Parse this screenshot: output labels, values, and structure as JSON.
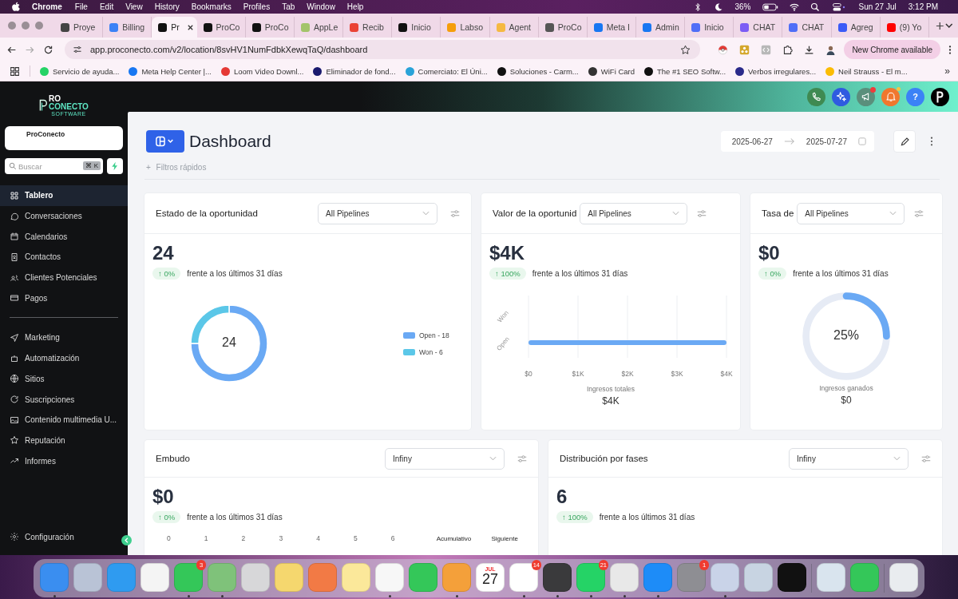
{
  "menubar": {
    "app": "Chrome",
    "menus": [
      "File",
      "Edit",
      "View",
      "History",
      "Bookmarks",
      "Profiles",
      "Tab",
      "Window",
      "Help"
    ],
    "battery": "36%",
    "date": "Sun 27 Jul",
    "time": "3:12 PM"
  },
  "tabs": [
    {
      "label": "Proye",
      "selected": false,
      "color": "#444444"
    },
    {
      "label": "Billing",
      "selected": false,
      "color": "#3b82f6"
    },
    {
      "label": "Pr",
      "selected": true,
      "color": "#111111"
    },
    {
      "label": "ProCo",
      "selected": false,
      "color": "#111111"
    },
    {
      "label": "ProCo",
      "selected": false,
      "color": "#111111"
    },
    {
      "label": "AppLe",
      "selected": false,
      "color": "#a3c46a"
    },
    {
      "label": "Recib",
      "selected": false,
      "color": "#ea4335"
    },
    {
      "label": "Inicio",
      "selected": false,
      "color": "#111111"
    },
    {
      "label": "Labso",
      "selected": false,
      "color": "#f59e0b"
    },
    {
      "label": "Agent",
      "selected": false,
      "color": "#f5b942"
    },
    {
      "label": "ProCo",
      "selected": false,
      "color": "#555555"
    },
    {
      "label": "Meta I",
      "selected": false,
      "color": "#1877f2"
    },
    {
      "label": "Admin",
      "selected": false,
      "color": "#1877f2"
    },
    {
      "label": "Inicio",
      "selected": false,
      "color": "#4f6ef7"
    },
    {
      "label": "CHAT",
      "selected": false,
      "color": "#7c5cf5"
    },
    {
      "label": "CHAT",
      "selected": false,
      "color": "#4f6ef7"
    },
    {
      "label": "Agreg",
      "selected": false,
      "color": "#3b5bf7"
    },
    {
      "label": "(9) Yo",
      "selected": false,
      "color": "#ff0000"
    }
  ],
  "toolbar": {
    "url": "app.proconecto.com/v2/location/8svHV1NumFdbkXewqTaQ/dashboard",
    "update_button": "New Chrome available"
  },
  "bookmarks": [
    {
      "label": "Servicio de ayuda...",
      "color": "#25d366"
    },
    {
      "label": "Meta Help Center |...",
      "color": "#1877f2"
    },
    {
      "label": "Loom Video Downl...",
      "color": "#e53935"
    },
    {
      "label": "Eliminador de fond...",
      "color": "#1a1a6e"
    },
    {
      "label": "Comerciato: El Úni...",
      "color": "#2aa3d8"
    },
    {
      "label": "Soluciones - Carm...",
      "color": "#111111"
    },
    {
      "label": "WiFi Card",
      "color": "#333333"
    },
    {
      "label": "The #1 SEO Softw...",
      "color": "#111111"
    },
    {
      "label": "Verbos irregulares...",
      "color": "#2a2a8a"
    },
    {
      "label": "Neil Strauss - El m...",
      "color": "#fbbc04"
    }
  ],
  "bookmarks_more": "»",
  "app": {
    "logo": {
      "line1": "RO",
      "line2": "CONECTO",
      "line3": "SOFTWARE"
    },
    "header_buttons": [
      {
        "kind": "phone",
        "color": "#3f8a52",
        "dot": false
      },
      {
        "kind": "sparkle",
        "color": "#2f5be0",
        "dot": false
      },
      {
        "kind": "megaphone",
        "color": "#5a8f7c",
        "dot": true
      },
      {
        "kind": "bell",
        "color": "#f0772e",
        "dot": true
      },
      {
        "kind": "help",
        "label": "?",
        "color": "#3b82f6",
        "dot": false
      },
      {
        "kind": "avatar",
        "color": "#000000",
        "dot": false
      }
    ],
    "sidebar": {
      "account": "ProConecto",
      "search_placeholder": "Buscar",
      "shortcut": "⌘ K",
      "items": [
        {
          "label": "Tablero",
          "kind": "grid",
          "selected": true
        },
        {
          "label": "Conversaciones",
          "kind": "chat",
          "selected": false
        },
        {
          "label": "Calendarios",
          "kind": "calendar",
          "selected": false
        },
        {
          "label": "Contactos",
          "kind": "contacts",
          "selected": false
        },
        {
          "label": "Clientes Potenciales",
          "kind": "people",
          "selected": false
        },
        {
          "label": "Pagos",
          "kind": "card",
          "selected": false
        }
      ],
      "items_2": [
        {
          "label": "Marketing",
          "kind": "send",
          "selected": false
        },
        {
          "label": "Automatización",
          "kind": "bot",
          "selected": false
        },
        {
          "label": "Sitios",
          "kind": "globe",
          "selected": false
        },
        {
          "label": "Suscripciones",
          "kind": "refresh",
          "selected": false
        },
        {
          "label": "Contenido multimedia U...",
          "kind": "image",
          "selected": false
        },
        {
          "label": "Reputación",
          "kind": "star",
          "selected": false
        },
        {
          "label": "Informes",
          "kind": "trend",
          "selected": false
        }
      ],
      "footer_item": "Configuración"
    },
    "dashboard": {
      "title": "Dashboard",
      "quick_filters_icon": "+",
      "quick_filters": "Filtros rápidos",
      "date_from": "2025-06-27",
      "date_to": "2025-07-27",
      "row_1": [
        {
          "kind": "donut",
          "title": "Estado de la oportunidad",
          "select": "All Pipelines",
          "value": "24",
          "change": "↑ 0%",
          "compare": "frente a los últimos 31 días",
          "center": "24",
          "legend": [
            {
              "color": "#6aa9f4"
            },
            {
              "color": "#5bc7e8"
            }
          ],
          "chart_data": {
            "type": "donut",
            "categories": [
              "Open - 18",
              "Won - 6"
            ],
            "values": [
              75,
              25
            ]
          }
        },
        {
          "kind": "bar",
          "title": "Valor de la oportunid",
          "select": "All Pipelines",
          "value": "$4K",
          "change": "↑ 100%",
          "compare": "frente a los últimos 31 días",
          "total": "$4K",
          "chart_data": {
            "type": "bar",
            "orientation": "horizontal",
            "grid": true,
            "categories": [
              "Won",
              "Open"
            ],
            "values": [
              0,
              4000
            ],
            "xlabel": "Ingresos totales",
            "xlim": [
              0,
              4000
            ],
            "xticks": [
              {
                "value": 0,
                "label": "$0"
              },
              {
                "value": 1000,
                "label": "$1K"
              },
              {
                "value": 2000,
                "label": "$2K"
              },
              {
                "value": 3000,
                "label": "$3K"
              },
              {
                "value": 4000,
                "label": "$4K"
              }
            ]
          }
        },
        {
          "kind": "gauge",
          "title": "Tasa de",
          "select": "All Pipelines",
          "value": "$0",
          "change": "↑ 0%",
          "compare": "frente a los últimos 31 días",
          "level": 0.25,
          "label": "25%",
          "caption": "Ingresos ganados",
          "total": "$0"
        }
      ],
      "row_2": [
        {
          "kind": "funnel",
          "title": "Embudo",
          "select": "Infiny",
          "value": "$0",
          "change": "↑ 0%",
          "compare": "frente a los últimos 31 días",
          "axis": [
            "0",
            "1",
            "2",
            "3",
            "4",
            "5",
            "6"
          ],
          "columns": [
            "Acumulativo",
            "Siguiente"
          ]
        },
        {
          "kind": "stages",
          "title": "Distribución por fases",
          "select": "Infiny",
          "value": "6",
          "change": "↑ 100%",
          "compare": "frente a los últimos 31 días"
        }
      ]
    }
  },
  "dock": [
    {
      "kind": "app",
      "color": "#3a8ef0",
      "running": true
    },
    {
      "kind": "app",
      "color": "#b9c3d6",
      "running": false
    },
    {
      "kind": "app",
      "color": "#2f9bf0",
      "running": false
    },
    {
      "kind": "app",
      "color": "#f4f4f4",
      "running": false
    },
    {
      "kind": "app",
      "color": "#34c759",
      "running": true,
      "badge": "3"
    },
    {
      "kind": "app",
      "color": "#7fc27a",
      "running": true
    },
    {
      "kind": "app",
      "color": "#d7d7d9",
      "running": false
    },
    {
      "kind": "app",
      "color": "#f5d76e",
      "running": false
    },
    {
      "kind": "app",
      "color": "#f27a45",
      "running": false
    },
    {
      "kind": "app",
      "color": "#fbe89a",
      "running": false
    },
    {
      "kind": "app",
      "color": "#f7f7f7",
      "running": true
    },
    {
      "kind": "app",
      "color": "#34c759",
      "running": false
    },
    {
      "kind": "app",
      "color": "#f4a03a",
      "running": true
    },
    {
      "kind": "calendar",
      "month": "JUL",
      "day": "27",
      "running": false
    },
    {
      "kind": "app",
      "color": "#ffffff",
      "running": true,
      "badge": "14"
    },
    {
      "kind": "app",
      "color": "#3a3a3c",
      "running": true
    },
    {
      "kind": "app",
      "color": "#25d366",
      "running": true,
      "badge": "21"
    },
    {
      "kind": "app",
      "color": "#e8e8e8",
      "running": true
    },
    {
      "kind": "app",
      "color": "#1d8cf8",
      "running": true
    },
    {
      "kind": "app",
      "color": "#8e8e93",
      "running": false,
      "badge": "1"
    },
    {
      "kind": "app",
      "color": "#c9d3e8",
      "running": true
    },
    {
      "kind": "app",
      "color": "#c8d4e2",
      "running": false
    },
    {
      "kind": "app",
      "color": "#111111",
      "running": false
    },
    {
      "kind": "separator"
    },
    {
      "kind": "app",
      "color": "#d9e4ee",
      "running": false
    },
    {
      "kind": "app",
      "color": "#34c759",
      "running": false
    },
    {
      "kind": "separator"
    },
    {
      "kind": "app",
      "color": "#e9ecef",
      "running": false
    }
  ]
}
